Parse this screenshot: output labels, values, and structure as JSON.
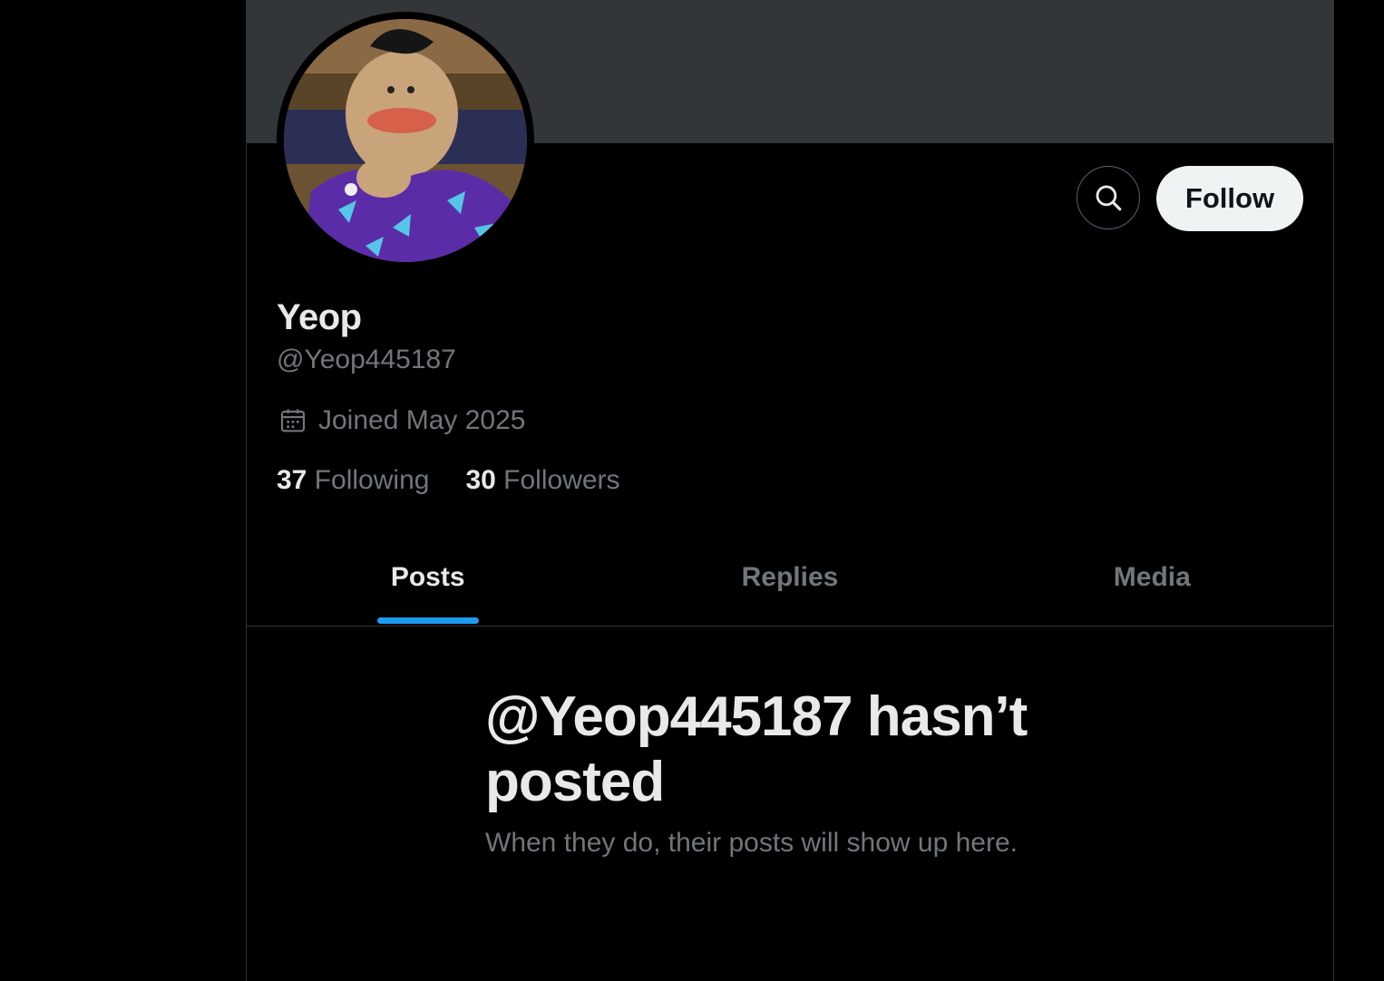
{
  "profile": {
    "display_name": "Yeop",
    "handle": "@Yeop445187",
    "joined": "Joined May 2025",
    "following_count": "37",
    "following_label": "Following",
    "followers_count": "30",
    "followers_label": "Followers"
  },
  "actions": {
    "search_icon": "search-icon",
    "follow_label": "Follow"
  },
  "tabs": [
    {
      "label": "Posts",
      "active": true
    },
    {
      "label": "Replies",
      "active": false
    },
    {
      "label": "Media",
      "active": false
    }
  ],
  "empty_state": {
    "title": "@Yeop445187 hasn’t posted",
    "subtitle": "When they do, their posts will show up here."
  },
  "colors": {
    "background": "#000000",
    "banner": "#333639",
    "accent": "#1d9bf0",
    "text_primary": "#e7e9ea",
    "text_secondary": "#71767b",
    "follow_button_bg": "#eff3f4"
  }
}
